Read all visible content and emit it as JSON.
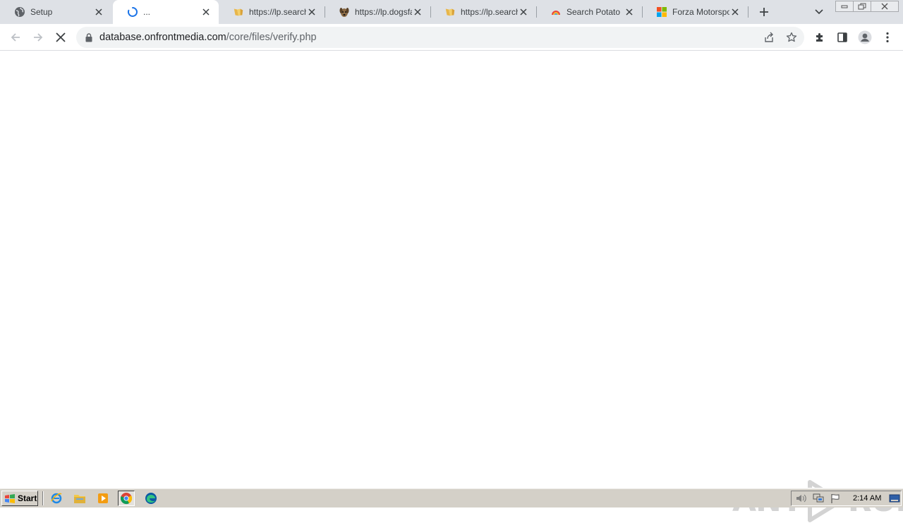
{
  "browser": {
    "tabs": [
      {
        "title": "Setup",
        "icon": "globe-icon",
        "active": false
      },
      {
        "title": "...",
        "icon": "loading-spinner-icon",
        "active": true
      },
      {
        "title": "https://lp.search-",
        "icon": "folder-page-icon",
        "active": false
      },
      {
        "title": "https://lp.dogsfan",
        "icon": "dog-icon",
        "active": false
      },
      {
        "title": "https://lp.search-",
        "icon": "folder-page-icon",
        "active": false
      },
      {
        "title": "Search Potato",
        "icon": "potato-logo-icon",
        "active": false
      },
      {
        "title": "Forza Motorsport",
        "icon": "microsoft-logo-icon",
        "active": false
      }
    ],
    "address": {
      "host": "database.onfrontmedia.com",
      "path": "/core/files/verify.php"
    }
  },
  "watermark": {
    "left": "ANY",
    "right": "RUN"
  },
  "taskbar": {
    "start_label": "Start",
    "quick_launch": [
      "internet-explorer-icon",
      "file-explorer-icon",
      "media-player-icon",
      "chrome-icon",
      "edge-icon"
    ],
    "tray": [
      "volume-icon",
      "network-icon",
      "flag-icon",
      "show-desktop-icon"
    ],
    "clock": "2:14 AM"
  },
  "colors": {
    "tabstrip": "#dee1e6",
    "taskbar": "#d4d0c8",
    "spinner": "#1a73e8"
  }
}
